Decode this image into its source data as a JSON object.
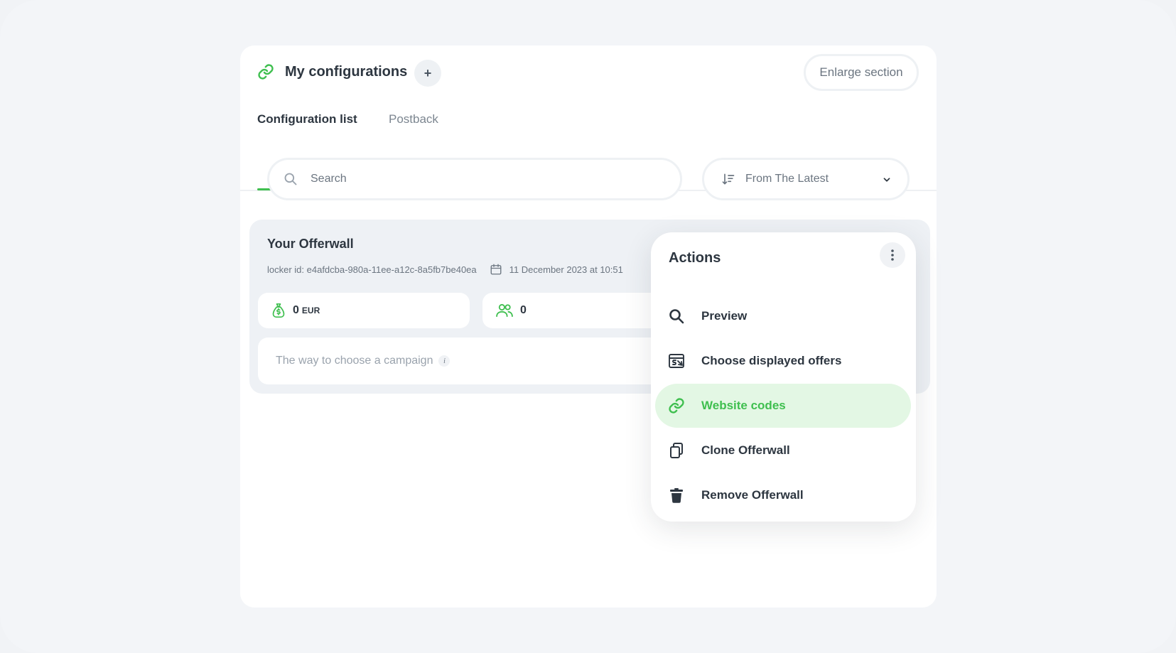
{
  "colors": {
    "accent": "#3fbf4f",
    "accent_bg": "#e3f7e4",
    "text_primary": "#2d3640",
    "text_muted": "#6b7580",
    "background": "#f3f5f8"
  },
  "header": {
    "title": "My configurations",
    "add_label": "+",
    "enlarge_label": "Enlarge section"
  },
  "tabs": [
    {
      "label": "Configuration list",
      "active": true
    },
    {
      "label": "Postback",
      "active": false
    }
  ],
  "search": {
    "placeholder": "Search",
    "value": ""
  },
  "sort": {
    "selected": "From The Latest"
  },
  "card": {
    "title": "Your Offerwall",
    "locker_id": "locker id: e4afdcba-980a-11ee-a12c-8a5fb7be40ea",
    "date": "11 December 2023 at 10:51",
    "revenue_value": "0",
    "revenue_unit": "EUR",
    "users_value": "0",
    "campaign_label": "The way to choose a campaign",
    "info_glyph": "i"
  },
  "actions_menu": {
    "title": "Actions",
    "items": [
      {
        "label": "Preview",
        "icon": "search-icon"
      },
      {
        "label": "Choose displayed offers",
        "icon": "offers-icon"
      },
      {
        "label": "Website codes",
        "icon": "link-icon",
        "active": true
      },
      {
        "label": "Clone Offerwall",
        "icon": "copy-icon"
      },
      {
        "label": "Remove Offerwall",
        "icon": "trash-icon"
      }
    ]
  }
}
